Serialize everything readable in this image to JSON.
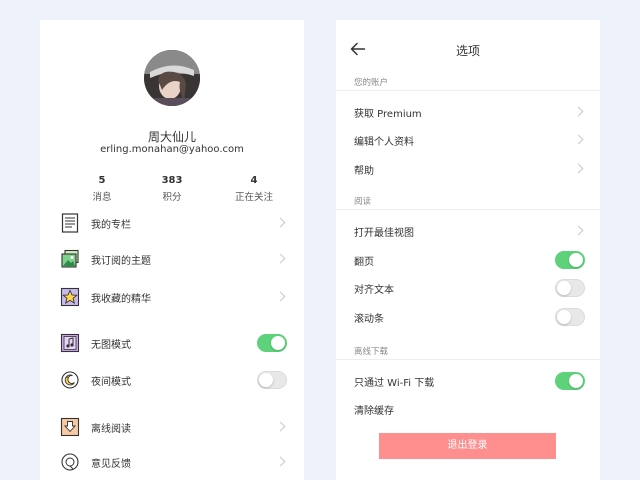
{
  "profile": {
    "name": "周大仙儿",
    "email": "erling.monahan@yahoo.com",
    "stats": [
      {
        "value": "5",
        "label": "消息"
      },
      {
        "value": "383",
        "label": "积分"
      },
      {
        "value": "4",
        "label": "正在关注"
      }
    ]
  },
  "menu": {
    "items": [
      {
        "label": "我的专栏",
        "icon": "document-icon"
      },
      {
        "label": "我订阅的主题",
        "icon": "image-stack-icon"
      },
      {
        "label": "我收藏的精华",
        "icon": "star-icon"
      },
      {
        "label": "无图模式",
        "icon": "music-note-icon",
        "toggle": true
      },
      {
        "label": "夜间模式",
        "icon": "moon-icon",
        "toggle": false
      },
      {
        "label": "离线阅读",
        "icon": "download-icon"
      },
      {
        "label": "意见反馈",
        "icon": "feedback-icon"
      }
    ]
  },
  "options": {
    "title": "选项",
    "sections": {
      "account": "您的账户",
      "reading": "阅读",
      "offline": "离线下载"
    },
    "items": {
      "premium": "获取 Premium",
      "edit_profile": "编辑个人资料",
      "help": "帮助",
      "best_view": "打开最佳视图",
      "page_turn": "翻页",
      "justify_text": "对齐文本",
      "scrollbar": "滚动条",
      "wifi_download": "只通过 Wi-Fi 下载",
      "clear_cache": "清除缓存"
    },
    "toggles": {
      "page_turn": true,
      "justify_text": false,
      "scrollbar": false,
      "wifi_download": true
    },
    "logout_label": "退出登录"
  },
  "colors": {
    "background": "#eef3fb",
    "toggle_on": "#5dd27a",
    "logout_button": "#ff8f8f"
  }
}
